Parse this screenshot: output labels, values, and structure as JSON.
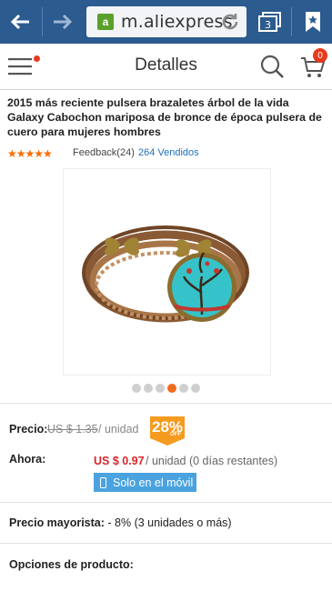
{
  "browser": {
    "url": "m.aliexpress",
    "tab_count": "3",
    "favicon_letter": "a"
  },
  "header": {
    "title": "Detalles",
    "cart_count": "0"
  },
  "product": {
    "title": "2015 más reciente pulsera brazaletes árbol de la vida Galaxy Cabochon mariposa de bronce de época pulsera de cuero para mujeres hombres",
    "rating_stars": "★★★★★",
    "rating_value": 5,
    "feedback": "Feedback(24)",
    "sold": "264 Vendidos",
    "image_count": 6,
    "active_image": 4
  },
  "pricing": {
    "price_label": "Precio:",
    "old_price": "US $ 1.35",
    "old_unit": "/ unidad",
    "discount": "28%",
    "discount_off": "OFF",
    "now_label": "Ahora:",
    "now_price": "US $ 0.97",
    "now_unit": "/ unidad (0 días restantes)",
    "mobile_only": "Solo en el móvil"
  },
  "wholesale": {
    "label": "Precio mayorista:",
    "value": " - 8% (3 unidades o más)"
  },
  "options": {
    "label": "Opciones de producto:"
  },
  "colors": {
    "browser_bar": "#2b5b8f",
    "accent_orange": "#f26a1b",
    "price_red": "#d9262a",
    "link_blue": "#1e6fba",
    "mobile_tag": "#4aa3df"
  }
}
